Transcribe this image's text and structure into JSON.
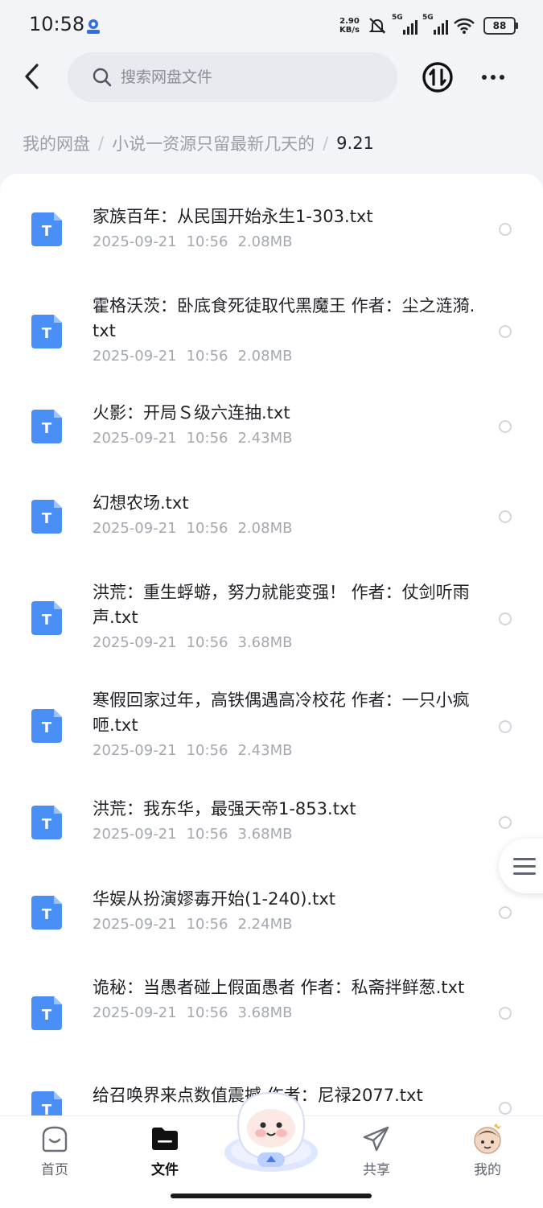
{
  "status_bar": {
    "time": "10:58",
    "net_speed_value": "2.90",
    "net_speed_unit": "KB/s",
    "sim1_label": "5G",
    "sim2_label": "5G",
    "battery": "88"
  },
  "search": {
    "placeholder": "搜索网盘文件"
  },
  "breadcrumb": {
    "items": [
      "我的网盘",
      "小说一资源只留最新几天的",
      "9.21"
    ],
    "separator": "/"
  },
  "files": [
    {
      "name": "家族百年：从民国开始永生1-303.txt",
      "date": "2025-09-21",
      "time": "10:56",
      "size": "2.08MB"
    },
    {
      "name": "霍格沃茨：卧底食死徒取代黑魔王 作者：尘之涟漪.txt",
      "date": "2025-09-21",
      "time": "10:56",
      "size": "2.08MB"
    },
    {
      "name": "火影：开局Ｓ级六连抽.txt",
      "date": "2025-09-21",
      "time": "10:56",
      "size": "2.43MB"
    },
    {
      "name": "幻想农场.txt",
      "date": "2025-09-21",
      "time": "10:56",
      "size": "2.08MB"
    },
    {
      "name": "洪荒：重生蜉蝣，努力就能变强！ 作者：仗剑听雨声.txt",
      "date": "2025-09-21",
      "time": "10:56",
      "size": "3.68MB"
    },
    {
      "name": "寒假回家过年，高铁偶遇高冷校花 作者：一只小疯咂.txt",
      "date": "2025-09-21",
      "time": "10:56",
      "size": "2.43MB"
    },
    {
      "name": "洪荒：我东华，最强天帝1-853.txt",
      "date": "2025-09-21",
      "time": "10:56",
      "size": "3.68MB"
    },
    {
      "name": "华娱从扮演嫪毐开始(1-240).txt",
      "date": "2025-09-21",
      "time": "10:56",
      "size": "2.24MB"
    },
    {
      "name": "诡秘：当愚者碰上假面愚者 作者：私斋拌鲜葱.txt",
      "date": "2025-09-21",
      "time": "10:56",
      "size": "3.68MB"
    },
    {
      "name": "给召唤界来点数值震撼 作者：尼禄2077.txt",
      "date": "",
      "time": "",
      "size": ""
    }
  ],
  "file_icon_letter": "T",
  "colors": {
    "file_icon_blue": "#4a8ff5",
    "bg": "#f3f4f7"
  },
  "nav": {
    "home": "首页",
    "files": "文件",
    "share": "共享",
    "mine": "我的"
  }
}
